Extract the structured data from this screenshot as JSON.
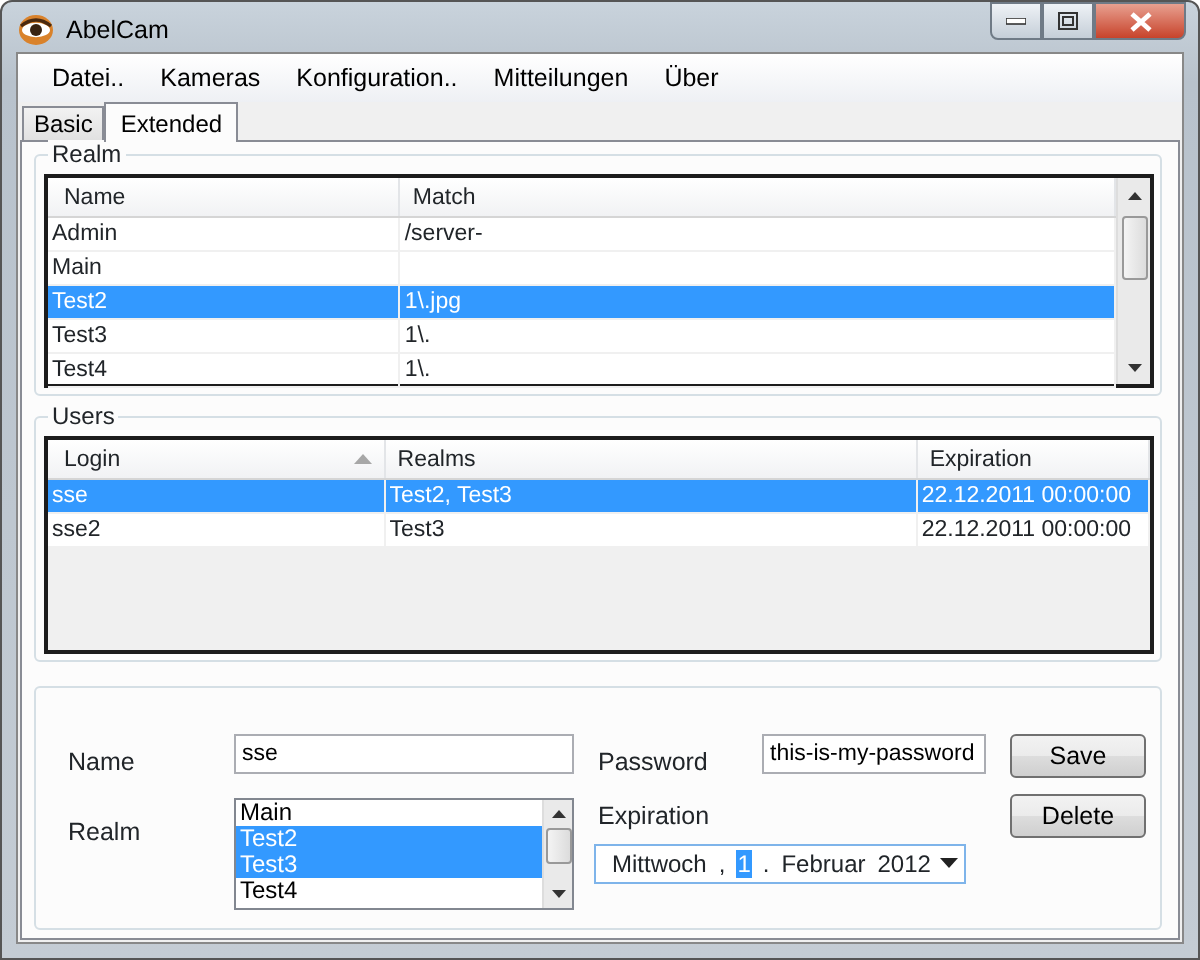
{
  "window": {
    "title": "AbelCam"
  },
  "menu": [
    "Datei..",
    "Kameras",
    "Konfiguration..",
    "Mitteilungen",
    "Über"
  ],
  "tabs": [
    {
      "label": "Basic",
      "selected": false
    },
    {
      "label": "Extended",
      "selected": true
    }
  ],
  "realm_group": {
    "title": "Realm",
    "columns": [
      "Name",
      "Match"
    ],
    "rows": [
      {
        "cells": [
          "Admin",
          "/server-"
        ],
        "selected": false
      },
      {
        "cells": [
          "Main",
          ""
        ],
        "selected": false
      },
      {
        "cells": [
          "Test2",
          "1\\.jpg"
        ],
        "selected": true
      },
      {
        "cells": [
          "Test3",
          "1\\."
        ],
        "selected": false
      },
      {
        "cells": [
          "Test4",
          "1\\."
        ],
        "selected": false
      }
    ]
  },
  "users_group": {
    "title": "Users",
    "columns": [
      {
        "label": "Login",
        "sorted": true
      },
      {
        "label": "Realms",
        "sorted": false
      },
      {
        "label": "Expiration",
        "sorted": false
      }
    ],
    "rows": [
      {
        "cells": [
          "sse",
          "Test2, Test3",
          "22.12.2011 00:00:00"
        ],
        "selected": true
      },
      {
        "cells": [
          "sse2",
          "Test3",
          "22.12.2011 00:00:00"
        ],
        "selected": false
      }
    ]
  },
  "form": {
    "name_label": "Name",
    "name_value": "sse",
    "password_label": "Password",
    "password_value": "this-is-my-password",
    "realm_label": "Realm",
    "realm_items": [
      {
        "label": "Main",
        "selected": false
      },
      {
        "label": "Test2",
        "selected": true
      },
      {
        "label": "Test3",
        "selected": true
      },
      {
        "label": "Test4",
        "selected": false
      }
    ],
    "expiration_label": "Expiration",
    "expiration_parts": [
      {
        "text": "Mittwoch",
        "selected": false
      },
      {
        "text": ",",
        "selected": false
      },
      {
        "text": "1",
        "selected": true
      },
      {
        "text": ".",
        "selected": false
      },
      {
        "text": "Februar",
        "selected": false
      },
      {
        "text": "2012",
        "selected": false
      }
    ],
    "buttons": [
      "Save",
      "Delete"
    ]
  }
}
